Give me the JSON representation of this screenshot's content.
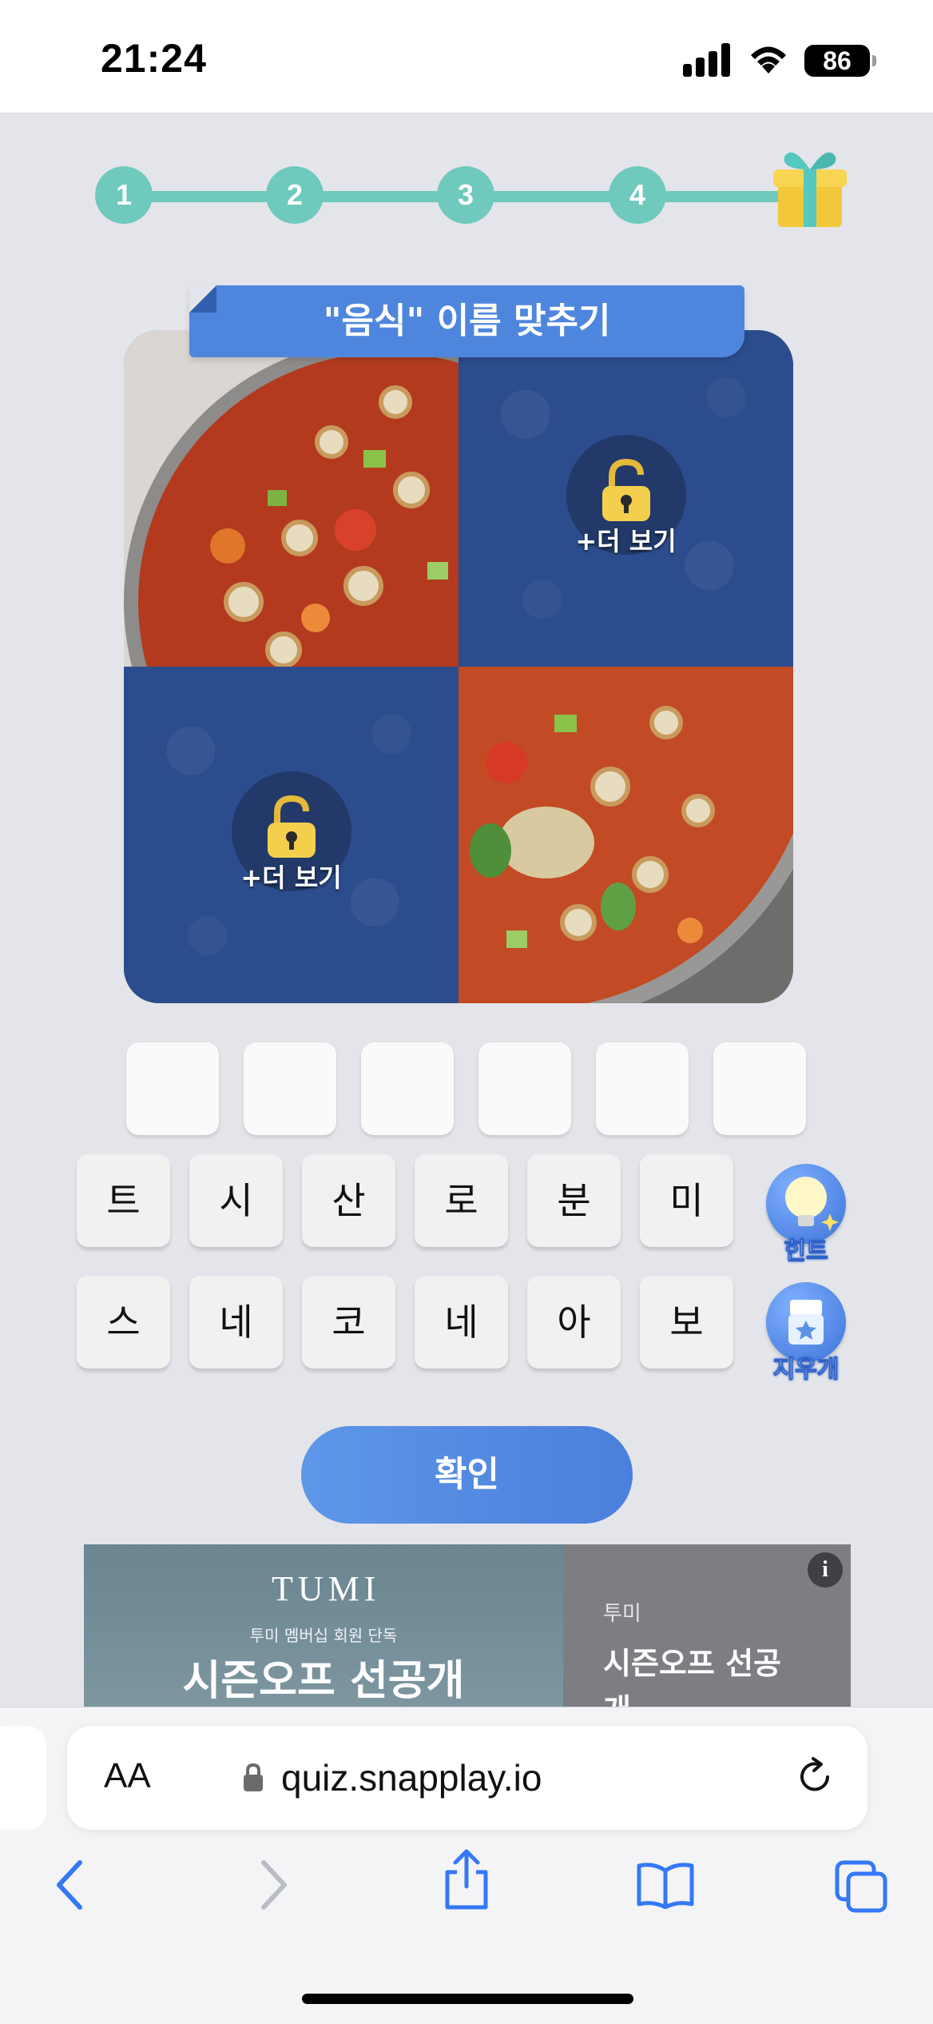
{
  "status_bar": {
    "time": "21:24",
    "battery": "86"
  },
  "progress": {
    "steps": [
      "1",
      "2",
      "3",
      "4"
    ],
    "reward_icon": "gift-icon"
  },
  "quiz": {
    "title": "\"음식\" 이름 맞추기",
    "locked_tile_label": "+더 보기",
    "answer_slot_count": 6
  },
  "keyboard": {
    "row1": [
      "트",
      "시",
      "산",
      "로",
      "분",
      "미"
    ],
    "row2": [
      "스",
      "네",
      "코",
      "네",
      "아",
      "보"
    ],
    "hint_label": "힌트",
    "eraser_label": "지우개"
  },
  "confirm_label": "확인",
  "ad": {
    "logo": "TUMI",
    "subtitle": "투미 멤버십 회원 단독",
    "headline": "시즌오프 선공개",
    "brand": "투미",
    "side_headline": "시즌오프 선공개",
    "info_icon": "i"
  },
  "browser": {
    "text_size_label": "AA",
    "url": "quiz.snapplay.io"
  },
  "colors": {
    "progress": "#6fc9bd",
    "accent": "#4f86dd",
    "locked_tile": "#2c4d8d"
  }
}
